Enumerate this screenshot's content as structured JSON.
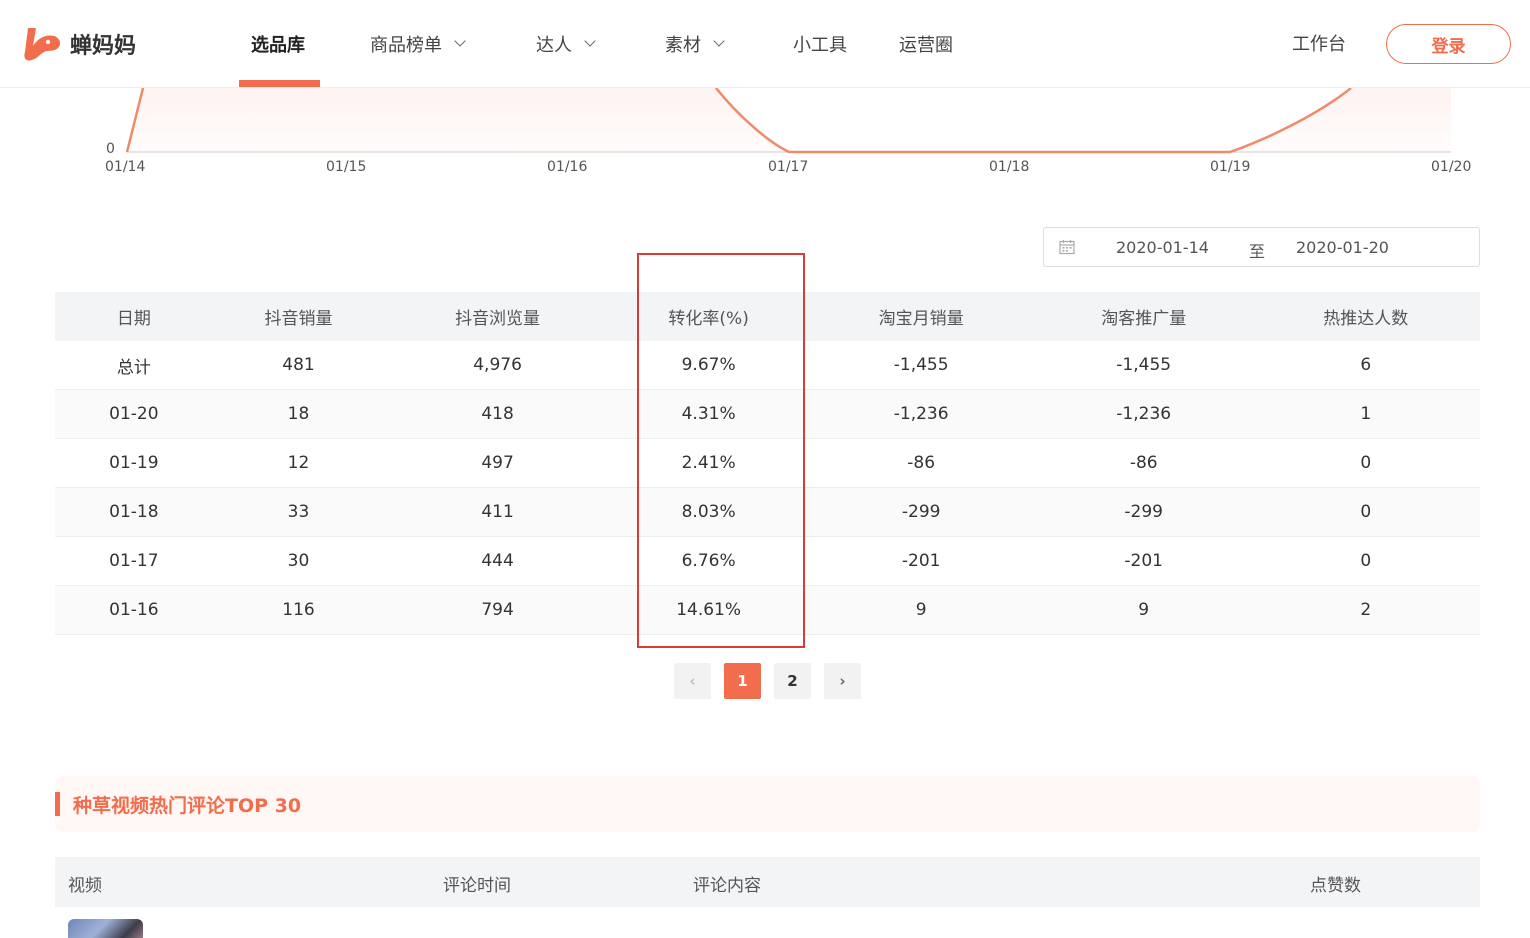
{
  "brand": {
    "name": "蝉妈妈",
    "accent": "#f26d4d"
  },
  "nav": {
    "items": [
      {
        "label": "选品库",
        "active": true,
        "dropdown": false
      },
      {
        "label": "商品榜单",
        "active": false,
        "dropdown": true
      },
      {
        "label": "达人",
        "active": false,
        "dropdown": true
      },
      {
        "label": "素材",
        "active": false,
        "dropdown": true
      },
      {
        "label": "小工具",
        "active": false,
        "dropdown": false
      },
      {
        "label": "运营圈",
        "active": false,
        "dropdown": false
      }
    ],
    "workbench": "工作台",
    "login": "登录"
  },
  "chart_data": {
    "type": "line",
    "x": [
      "01/14",
      "01/15",
      "01/16",
      "01/17",
      "01/18",
      "01/19",
      "01/20"
    ],
    "y_visible_min_label": "0",
    "series_color": "#f26d4d"
  },
  "date_range": {
    "start": "2020-01-14",
    "separator": "至",
    "end": "2020-01-20"
  },
  "table": {
    "headers": [
      "日期",
      "抖音销量",
      "抖音浏览量",
      "转化率(%)",
      "淘宝月销量",
      "淘客推广量",
      "热推达人数"
    ],
    "rows": [
      [
        "总计",
        "481",
        "4,976",
        "9.67%",
        "-1,455",
        "-1,455",
        "6"
      ],
      [
        "01-20",
        "18",
        "418",
        "4.31%",
        "-1,236",
        "-1,236",
        "1"
      ],
      [
        "01-19",
        "12",
        "497",
        "2.41%",
        "-86",
        "-86",
        "0"
      ],
      [
        "01-18",
        "33",
        "411",
        "8.03%",
        "-299",
        "-299",
        "0"
      ],
      [
        "01-17",
        "30",
        "444",
        "6.76%",
        "-201",
        "-201",
        "0"
      ],
      [
        "01-16",
        "116",
        "794",
        "14.61%",
        "9",
        "9",
        "2"
      ]
    ]
  },
  "pagination": {
    "pages": [
      "1",
      "2"
    ],
    "current": "1",
    "prev": "‹",
    "next": "›"
  },
  "comments": {
    "title": "种草视频热门评论TOP 30",
    "headers": [
      "视频",
      "评论时间",
      "评论内容",
      "点赞数"
    ]
  }
}
